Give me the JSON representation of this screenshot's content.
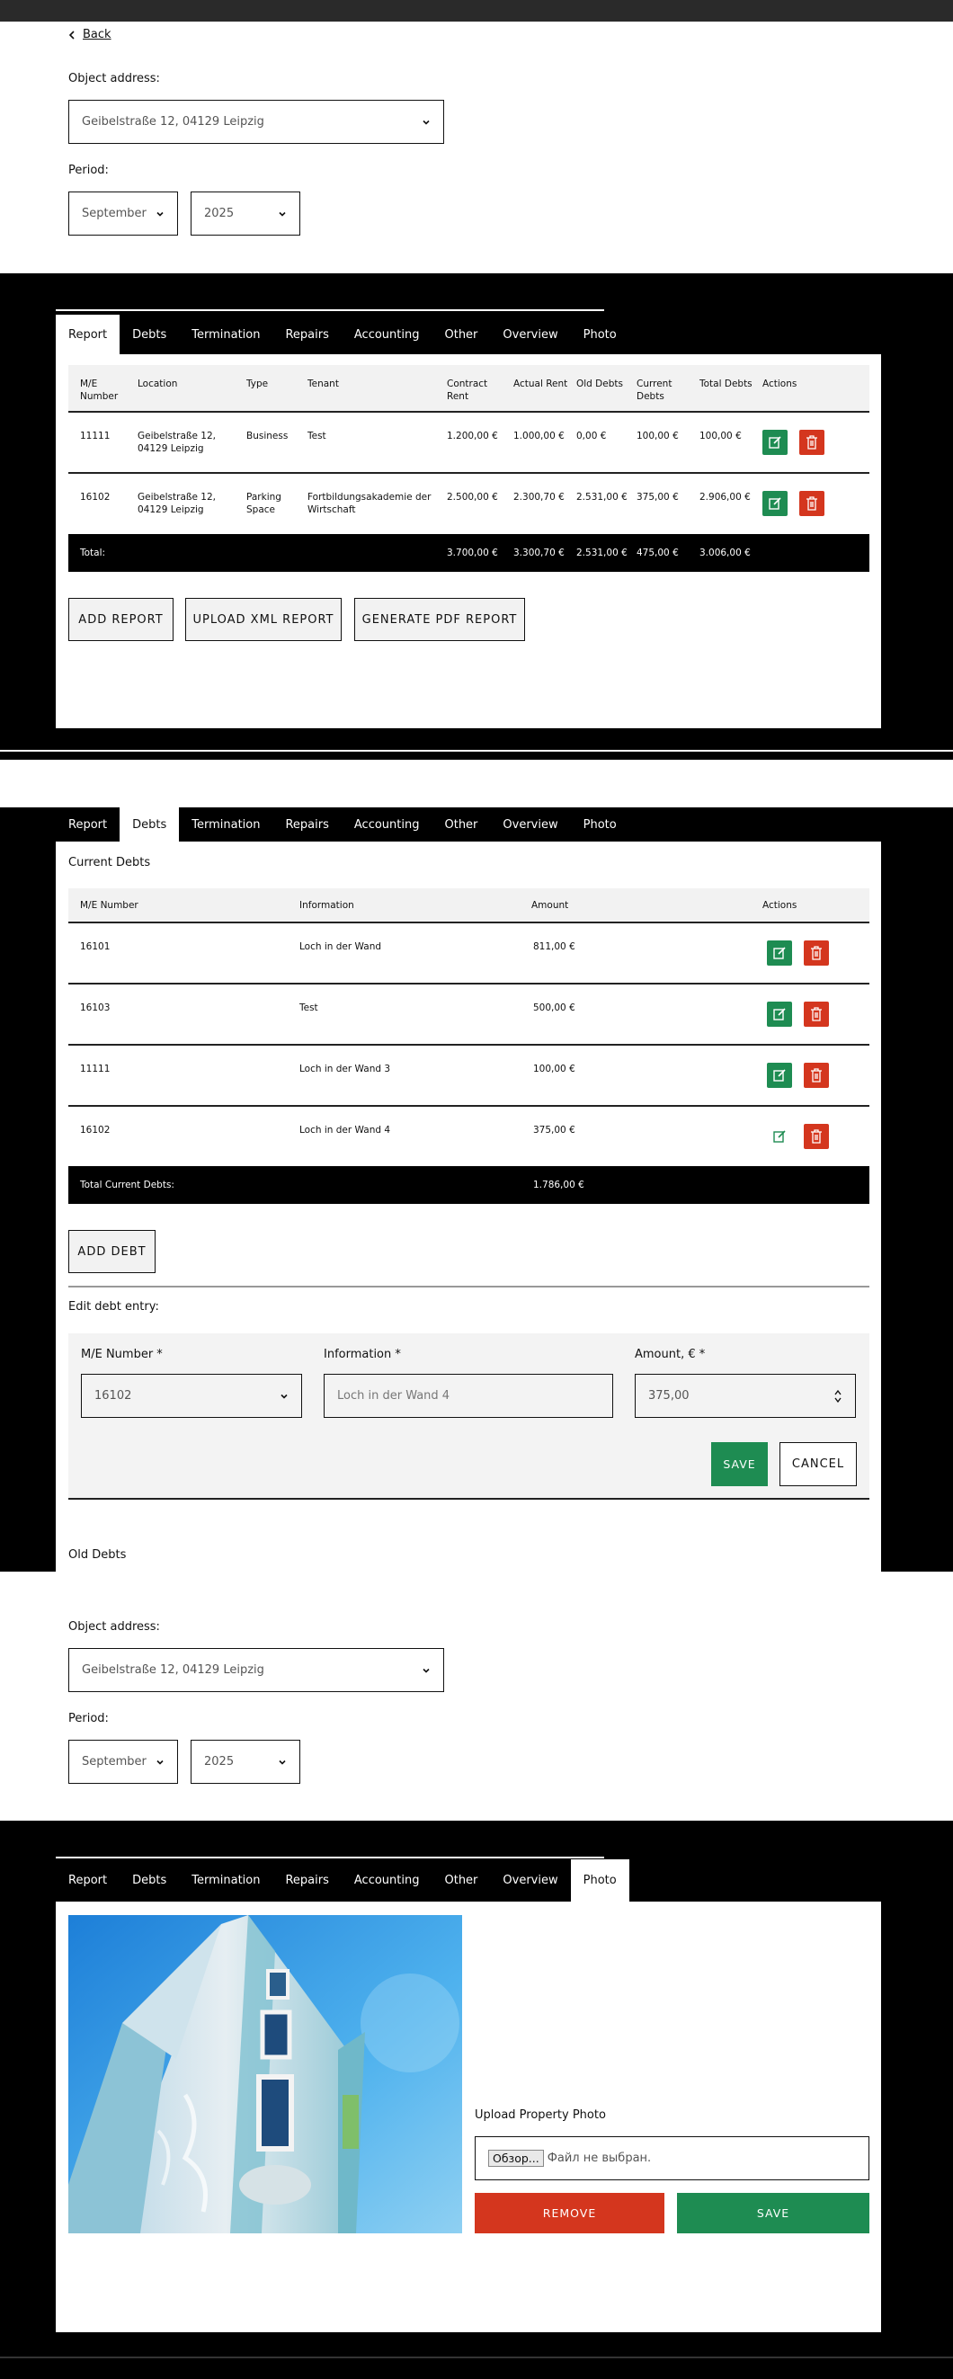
{
  "nav": {
    "back_label": "Back"
  },
  "filters1": {
    "address_label": "Object address:",
    "address_value": "Geibelstraße 12, 04129 Leipzig",
    "period_label": "Period:",
    "month": "September",
    "year": "2025"
  },
  "filters2": {
    "address_label": "Object address:",
    "address_value": "Geibelstraße 12, 04129 Leipzig",
    "period_label": "Period:",
    "month": "September",
    "year": "2025"
  },
  "tabs": [
    "Report",
    "Debts",
    "Termination",
    "Repairs",
    "Accounting",
    "Other",
    "Overview",
    "Photo"
  ],
  "report": {
    "headers": [
      "M/E Number",
      "Location",
      "Type",
      "Tenant",
      "Contract Rent",
      "Actual Rent",
      "Old Debts",
      "Current Debts",
      "Total Debts",
      "Actions"
    ],
    "rows": [
      [
        "11111",
        "Geibelstraße 12, 04129 Leipzig",
        "Business",
        "Test",
        "1.200,00 €",
        "1.000,00 €",
        "0,00 €",
        "100,00 €",
        "100,00 €"
      ],
      [
        "16102",
        "Geibelstraße 12, 04129 Leipzig",
        "Parking Space",
        "Fortbildungsakademie der Wirtschaft",
        "2.500,00 €",
        "2.300,70 €",
        "2.531,00 €",
        "375,00 €",
        "2.906,00 €"
      ]
    ],
    "total_label": "Total:",
    "totals": [
      "3.700,00 €",
      "3.300,70 €",
      "2.531,00 €",
      "475,00 €",
      "3.006,00 €"
    ],
    "buttons": {
      "add": "ADD REPORT",
      "upload": "UPLOAD XML REPORT",
      "pdf": "GENERATE PDF REPORT"
    }
  },
  "debts": {
    "section_title": "Current Debts",
    "headers": [
      "M/E Number",
      "Information",
      "Amount",
      "Actions"
    ],
    "rows": [
      [
        "16101",
        "Loch in der Wand",
        "811,00 €"
      ],
      [
        "16103",
        "Test",
        "500,00 €"
      ],
      [
        "11111",
        "Loch in der Wand 3",
        "100,00 €"
      ],
      [
        "16102",
        "Loch in der Wand 4",
        "375,00 €"
      ]
    ],
    "total_label": "Total Current Debts:",
    "total_value": "1.786,00 €",
    "add_button": "ADD DEBT",
    "edit_title": "Edit debt entry:",
    "form": {
      "me_label": "M/E Number *",
      "me_value": "16102",
      "info_label": "Information *",
      "info_placeholder": "Loch in der Wand 4",
      "amount_label": "Amount, € *",
      "amount_value": "375,00",
      "save": "SAVE",
      "cancel": "CANCEL"
    },
    "old_title": "Old Debts"
  },
  "photo": {
    "upload_label": "Upload Property Photo",
    "file_button": "Обзор...",
    "file_status": "Файл не выбран.",
    "remove": "REMOVE",
    "save": "SAVE"
  },
  "colors": {
    "green": "#1e8c52",
    "red": "#d4361e",
    "black": "#000000"
  }
}
